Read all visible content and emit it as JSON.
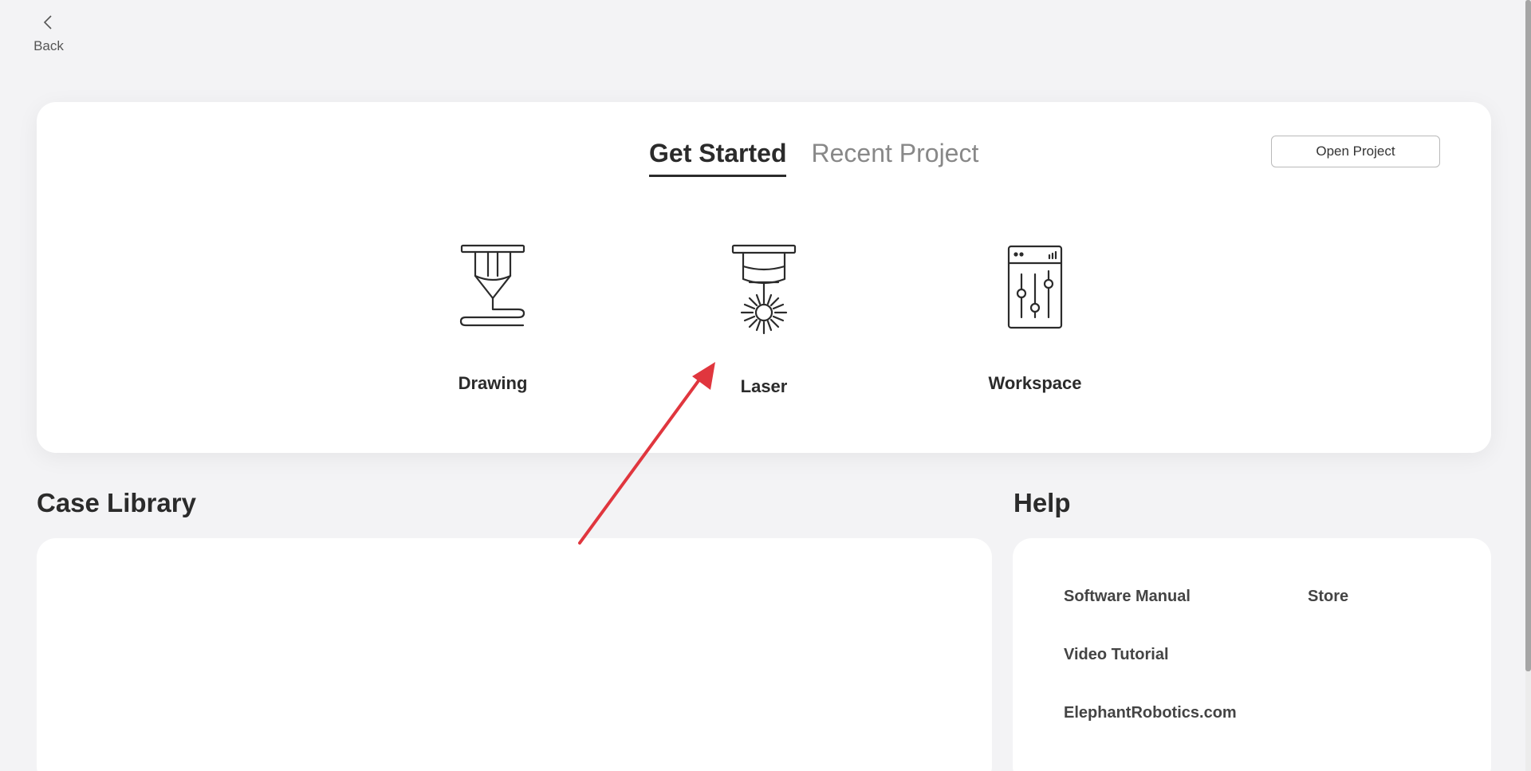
{
  "nav": {
    "back_label": "Back"
  },
  "start": {
    "tabs": [
      {
        "label": "Get Started",
        "active": true
      },
      {
        "label": "Recent Project",
        "active": false
      }
    ],
    "open_project_label": "Open Project",
    "modes": [
      {
        "label": "Drawing",
        "icon": "pen-plotter-icon"
      },
      {
        "label": "Laser",
        "icon": "laser-head-icon"
      },
      {
        "label": "Workspace",
        "icon": "sliders-panel-icon"
      }
    ]
  },
  "case_library": {
    "title": "Case Library"
  },
  "help": {
    "title": "Help",
    "links": [
      "Software Manual",
      "Store",
      "Video Tutorial",
      "ElephantRobotics.com"
    ]
  },
  "colors": {
    "background": "#f3f3f5",
    "card": "#ffffff",
    "text": "#2b2b2b",
    "muted_text": "#888888",
    "annotation_arrow": "#e0363e"
  }
}
